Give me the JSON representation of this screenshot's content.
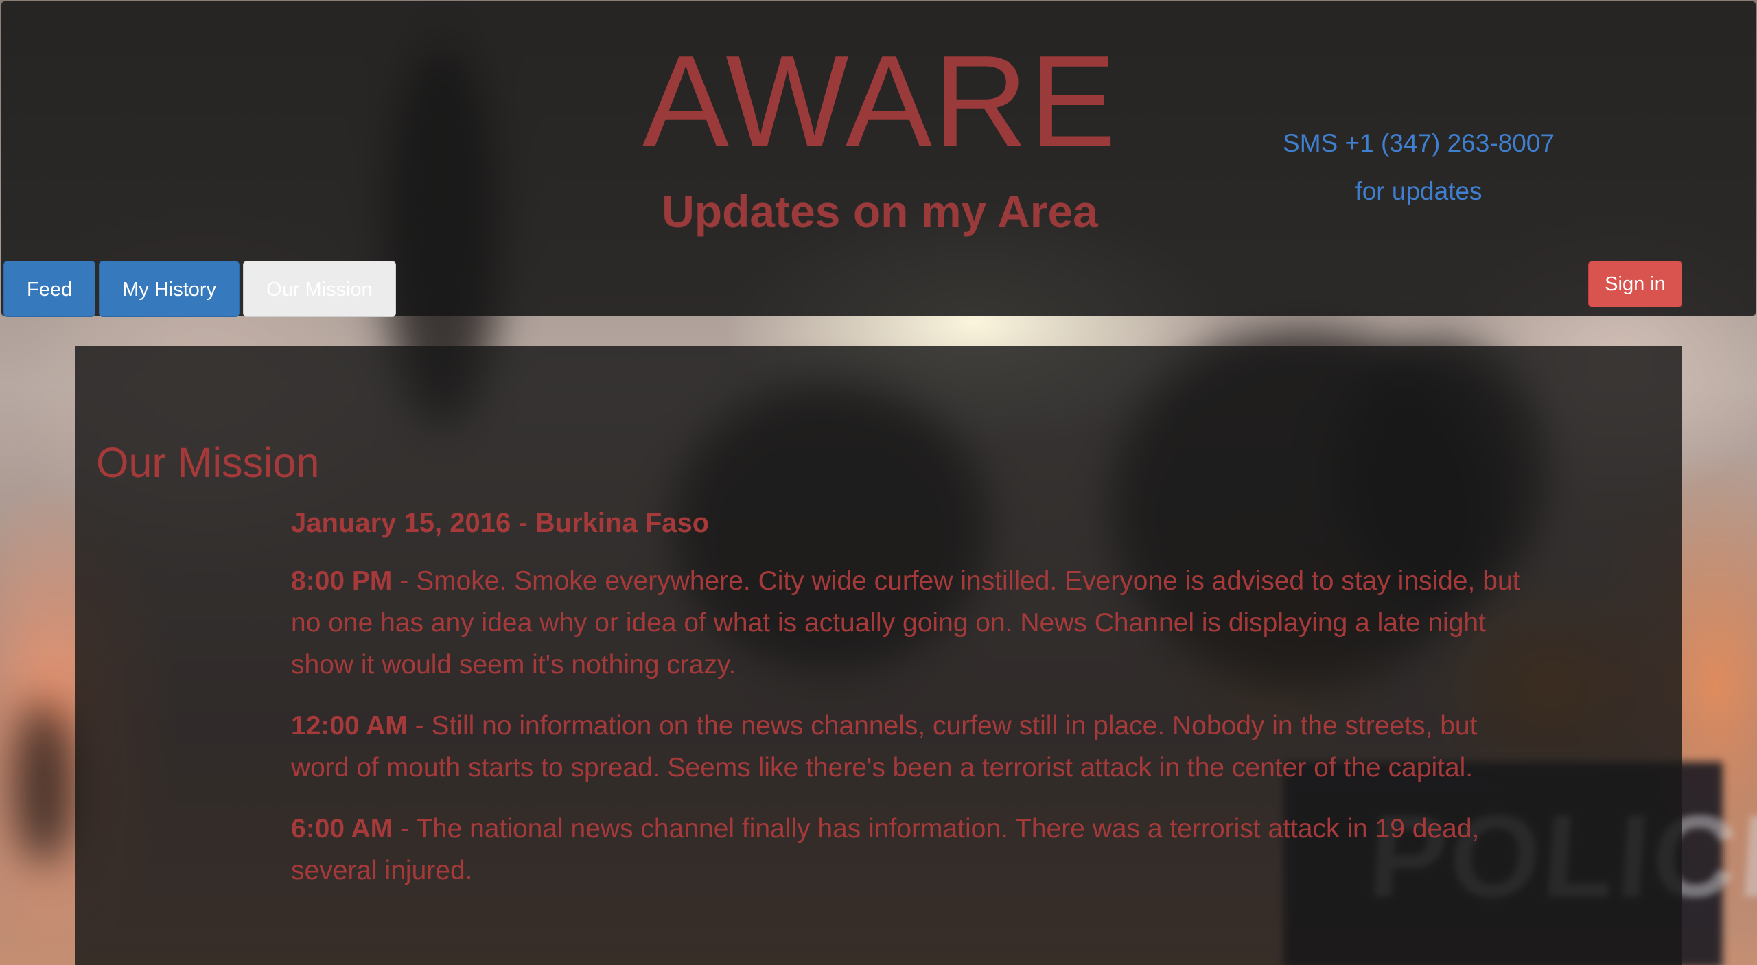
{
  "header": {
    "title": "AWARE",
    "subtitle": "Updates on my Area",
    "sms_line1": "SMS +1 (347) 263-8007",
    "sms_line2": "for updates",
    "signin_label": "Sign in"
  },
  "tabs": [
    {
      "label": "Feed",
      "active": false
    },
    {
      "label": "My History",
      "active": false
    },
    {
      "label": "Our Mission",
      "active": true
    }
  ],
  "colors": {
    "accent_red": "#a63a3a",
    "link_blue": "#3f7fcf",
    "tab_blue": "#3779bd",
    "signin_red": "#d9534f"
  },
  "main": {
    "section_title": "Our Mission",
    "date_line": "January 15, 2016 - Burkina Faso",
    "entries": [
      {
        "time": "8:00 PM",
        "text": " - Smoke. Smoke everywhere. City wide curfew instilled. Everyone is advised to stay inside, but no one has any idea why or idea of what is actually going on. News Channel is displaying a late night show it would seem it's nothing crazy."
      },
      {
        "time": "12:00 AM",
        "text": " - Still no information on the news channels, curfew still in place. Nobody in the streets, but word of mouth starts to spread. Seems like there's been a terrorist attack in the center of the capital."
      },
      {
        "time": "6:00 AM",
        "text": " - The national news channel finally has information. There was a terrorist attack in 19 dead, several injured."
      }
    ]
  },
  "background": {
    "sign_text": "POLICE"
  }
}
